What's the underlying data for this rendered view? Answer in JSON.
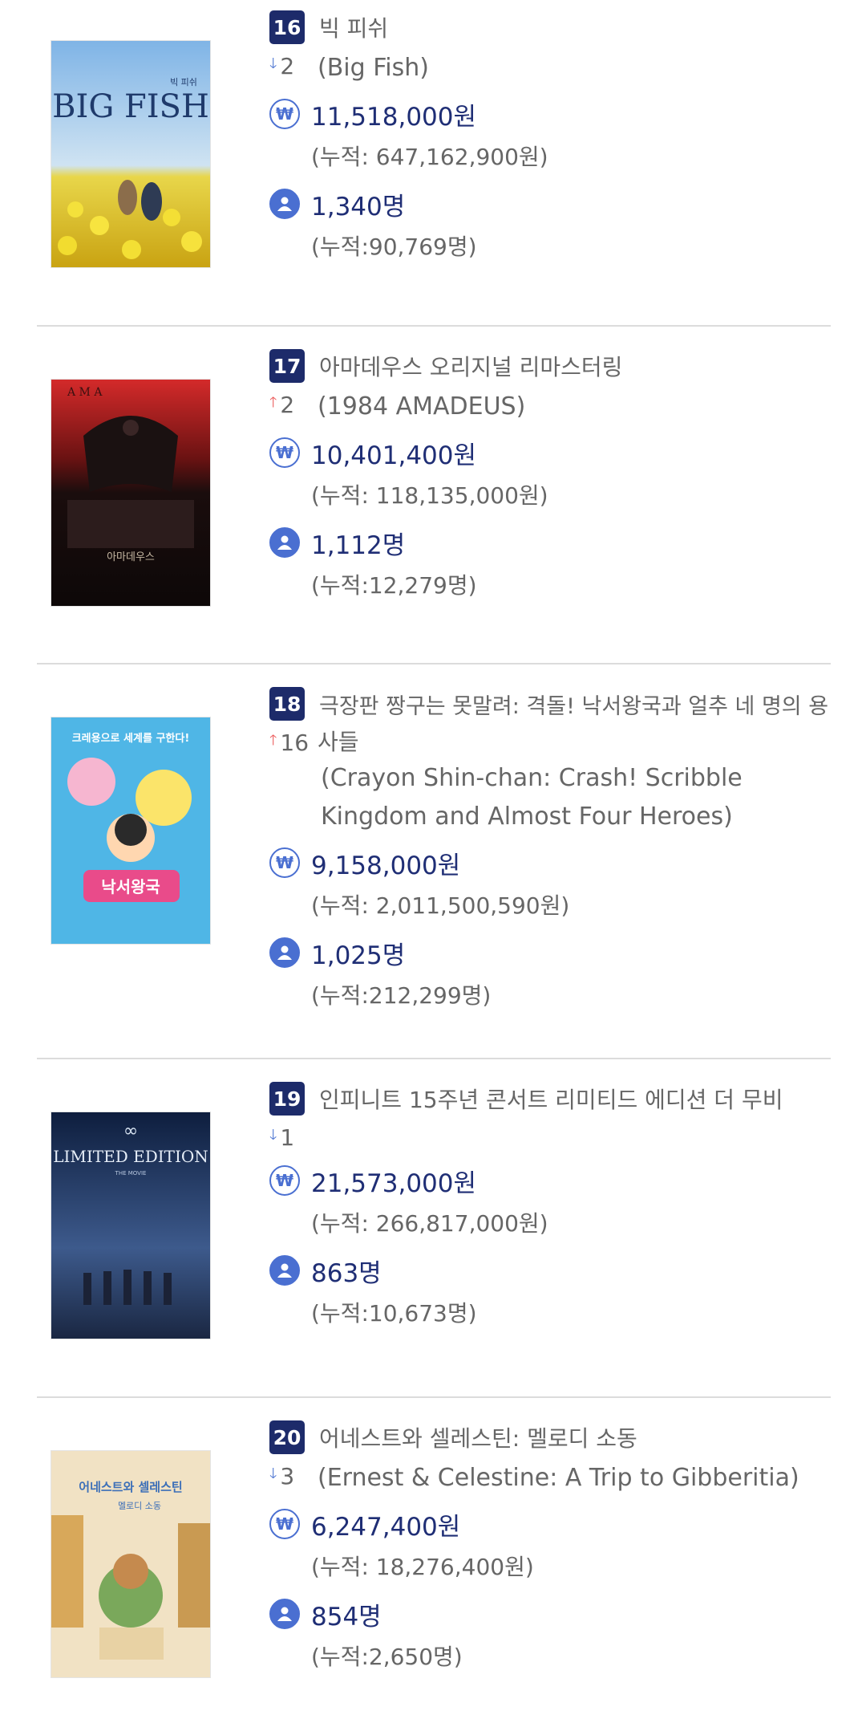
{
  "movies": [
    {
      "rank": "16",
      "change_dir": "down",
      "change": "2",
      "title": "빅 피쉬",
      "original": "(Big Fish)",
      "revenue": "11,518,000원",
      "revenue_total": "(누적: 647,162,900원)",
      "audience": "1,340명",
      "audience_total": "(누적:90,769명)",
      "poster_text": "BIG FISH",
      "poster_sub": "빅 피쉬"
    },
    {
      "rank": "17",
      "change_dir": "up",
      "change": "2",
      "title": "아마데우스 오리지널 리마스터링",
      "original": "(1984 AMADEUS)",
      "revenue": "10,401,400원",
      "revenue_total": "(누적: 118,135,000원)",
      "audience": "1,112명",
      "audience_total": "(누적:12,279명)",
      "poster_text": "아마데우스",
      "poster_sub": "A M A"
    },
    {
      "rank": "18",
      "change_dir": "up",
      "change": "16",
      "title": "극장판 짱구는 못말려: 격돌! 낙서왕국과 얼추 네 명의 용",
      "title_cont": "사들",
      "original_line1": "(Crayon Shin-chan: Crash! Scribble",
      "original_line2": "Kingdom and Almost Four Heroes)",
      "revenue": "9,158,000원",
      "revenue_total": "(누적: 2,011,500,590원)",
      "audience": "1,025명",
      "audience_total": "(누적:212,299명)",
      "poster_text": "낙서왕국",
      "poster_sub": "크레용으로 세계를 구한다!"
    },
    {
      "rank": "19",
      "change_dir": "down",
      "change": "1",
      "title": "인피니트 15주년 콘서트 리미티드 에디션 더 무비",
      "revenue": "21,573,000원",
      "revenue_total": "(누적: 266,817,000원)",
      "audience": "863명",
      "audience_total": "(누적:10,673명)",
      "poster_text": "LIMITED EDITION",
      "poster_sub": "THE MOVIE"
    },
    {
      "rank": "20",
      "change_dir": "down",
      "change": "3",
      "title": "어네스트와 셀레스틴: 멜로디 소동",
      "original": "(Ernest & Celestine: A Trip to Gibberitia)",
      "revenue": "6,247,400원",
      "revenue_total": "(누적: 18,276,400원)",
      "audience": "854명",
      "audience_total": "(누적:2,650명)",
      "poster_text": "어네스트와 셀레스틴",
      "poster_sub": "멜로디 소동"
    }
  ],
  "icons": {
    "won": "won-icon",
    "user": "user-icon"
  },
  "colors": {
    "rank_bg": "#1d2b6a",
    "value": "#1f2e75",
    "icon": "#4a6fd1",
    "up": "#ec5a5a",
    "down": "#4a73d1"
  }
}
